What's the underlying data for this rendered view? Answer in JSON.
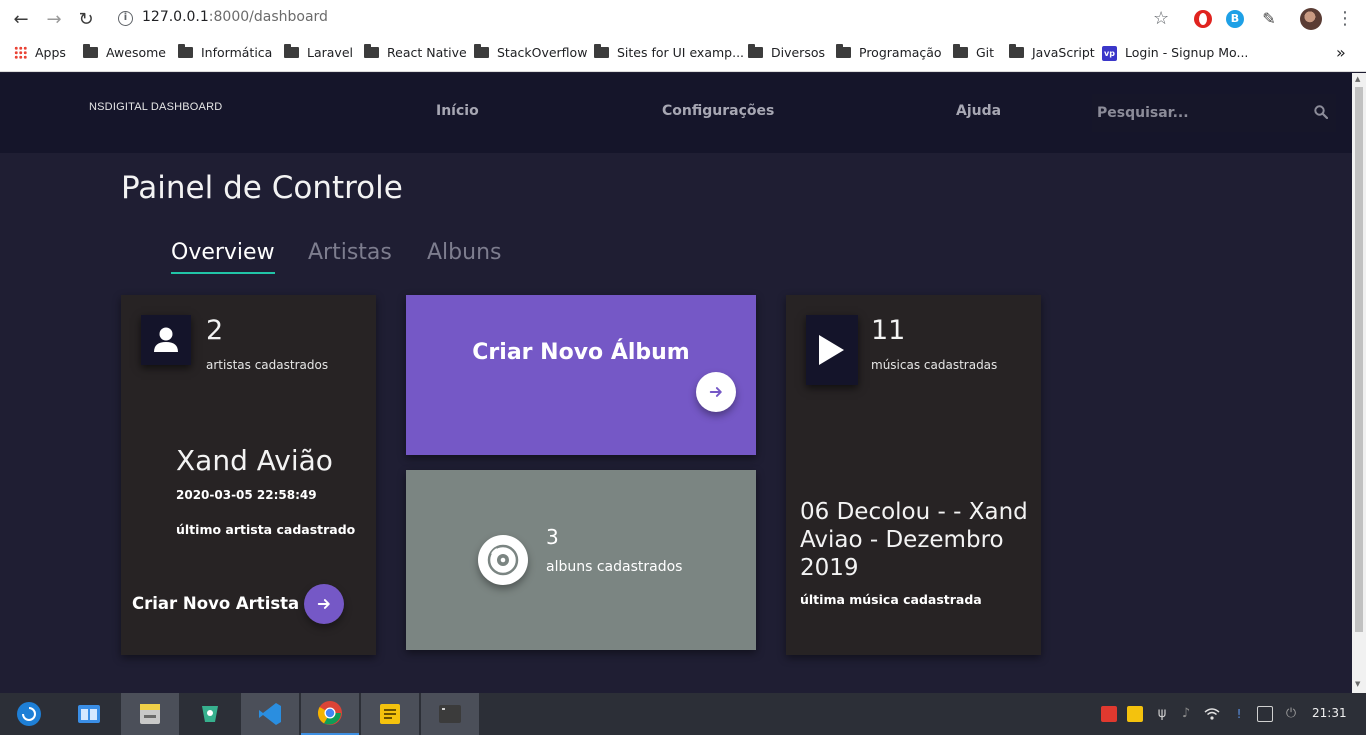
{
  "browser": {
    "url_host": "127.0.0.1",
    "url_path": ":8000/dashboard",
    "bookmarks": [
      "Apps",
      "Awesome",
      "Informática",
      "Laravel",
      "React Native",
      "StackOverflow",
      "Sites for UI examp...",
      "Diversos",
      "Programação",
      "Git",
      "JavaScript",
      "Login - Signup Mo..."
    ]
  },
  "header": {
    "brand": "NSDIGITAL DASHBOARD",
    "nav": [
      "Início",
      "Configurações",
      "Ajuda"
    ],
    "search_placeholder": "Pesquisar..."
  },
  "page": {
    "title": "Painel de Controle",
    "tabs": [
      "Overview",
      "Artistas",
      "Albuns"
    ],
    "active_tab": "Overview"
  },
  "artists_card": {
    "count": "2",
    "count_label": "artistas cadastrados",
    "latest_name": "Xand Avião",
    "latest_date": "2020-03-05 22:58:49",
    "latest_label": "último artista cadastrado",
    "cta": "Criar Novo Artista"
  },
  "new_album_card": {
    "title": "Criar Novo Álbum"
  },
  "albums_card": {
    "count": "3",
    "count_label": "albuns cadastrados"
  },
  "songs_card": {
    "count": "11",
    "count_label": "músicas cadastradas",
    "latest_title": "06 Decolou - - Xand Aviao - Dezembro 2019",
    "latest_label": "última música cadastrada"
  },
  "taskbar": {
    "time": "21:31"
  },
  "colors": {
    "accent_purple": "#7558c6",
    "accent_teal": "#21c4a7",
    "album_card": "#7b8582",
    "header_bg": "#15152a",
    "page_bg": "#1f1e33"
  }
}
